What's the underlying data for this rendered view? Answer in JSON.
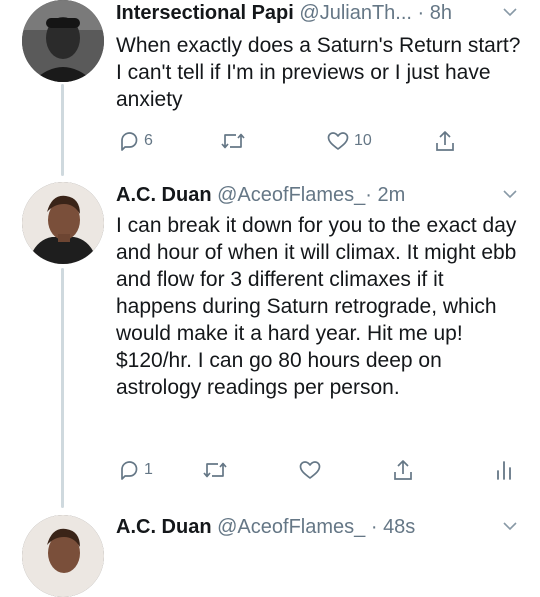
{
  "tweets": [
    {
      "name": "Intersectional Papi",
      "handle": "@JulianTh...",
      "separator": "·",
      "time": "8h",
      "text": "When exactly does a Saturn's Return start? I can't tell if I'm in previews or I just have anxiety",
      "replies": "6",
      "retweets": "",
      "likes": "10"
    },
    {
      "name": "A.C. Duan",
      "handle": "@AceofFlames_",
      "separator": "·",
      "time": "2m",
      "text": "I can break it down for you to the exact day and hour of when it will climax. It might ebb and flow for 3 different climaxes if it happens during Saturn retrograde, which would make it a hard year. Hit me up! $120/hr. I can go 80 hours deep on astrology readings per person.",
      "replies": "1",
      "retweets": "",
      "likes": ""
    },
    {
      "name": "A.C. Duan",
      "handle": "@AceofFlames_",
      "separator": "·",
      "time": "48s"
    }
  ],
  "colors": {
    "text": "#14171a",
    "secondary": "#657786",
    "thread_line": "#cfd9de"
  },
  "icons": [
    "reply-icon",
    "retweet-icon",
    "like-icon",
    "share-icon",
    "analytics-icon",
    "chevron-down-icon"
  ]
}
